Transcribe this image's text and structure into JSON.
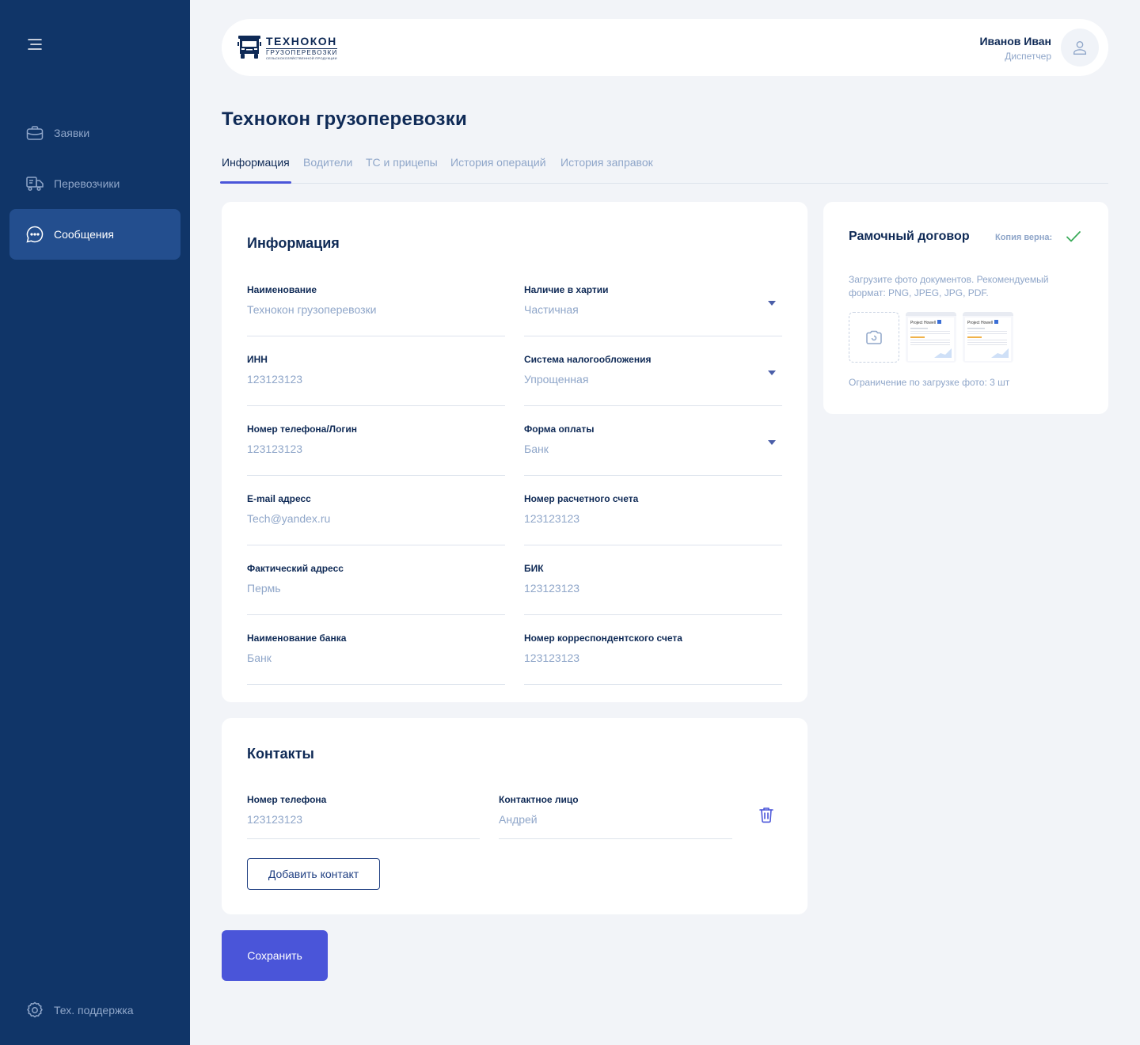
{
  "sidebar": {
    "menu_icon": "hamburger-icon",
    "items": [
      {
        "label": "Заявки",
        "icon": "briefcase-icon"
      },
      {
        "label": "Перевозчики",
        "icon": "truck-icon"
      },
      {
        "label": "Сообщения",
        "icon": "chat-icon",
        "active": true
      }
    ],
    "support": {
      "label": "Тех. поддержка",
      "icon": "gear-icon"
    }
  },
  "header": {
    "logo": {
      "title": "ТЕХНОКОН",
      "subtitle": "ГРУЗОПЕРЕВОЗКИ",
      "tagline": "СЕЛЬСКОХОЗЯЙСТВЕННОЙ ПРОДУКЦИИ"
    },
    "user": {
      "name": "Иванов Иван",
      "role": "Диспетчер"
    }
  },
  "page": {
    "title": "Технокон грузоперевозки"
  },
  "tabs": [
    "Информация",
    "Водители",
    "ТС и прицепы",
    "История операций",
    "История заправок"
  ],
  "info": {
    "title": "Информация",
    "fields": [
      {
        "label": "Наименование",
        "value": "Технокон грузоперевозки"
      },
      {
        "label": "Наличие в хартии",
        "value": "Частичная",
        "dropdown": true
      },
      {
        "label": "ИНН",
        "value": "123123123"
      },
      {
        "label": "Система налогообложения",
        "value": "Упрощенная",
        "dropdown": true
      },
      {
        "label": "Номер телефона/Логин",
        "value": "123123123"
      },
      {
        "label": "Форма оплаты",
        "value": "Банк",
        "dropdown": true
      },
      {
        "label": "E-mail адресс",
        "value": "Tech@yandex.ru"
      },
      {
        "label": "Номер расчетного счета",
        "value": "123123123"
      },
      {
        "label": "Фактический адресс",
        "value": "Пермь"
      },
      {
        "label": "БИК",
        "value": "123123123"
      },
      {
        "label": "Наименование банка",
        "value": "Банк"
      },
      {
        "label": "Номер корреспондентского счета",
        "value": "123123123"
      }
    ]
  },
  "contacts": {
    "title": "Контакты",
    "phone": {
      "label": "Номер телефона",
      "value": "123123123"
    },
    "person": {
      "label": "Контактное лицо",
      "value": "Андрей"
    },
    "add_button": "Добавить контакт"
  },
  "save_button": "Сохранить",
  "contract": {
    "title": "Рамочный договор",
    "copy_label": "Копия верна:",
    "hint": "Загрузите фото документов. Рекомендуемый формат: PNG, JPEG, JPG, PDF.",
    "limit": "Ограничение по загрузке фото: 3 шт",
    "thumb_title": "Project Howell"
  },
  "colors": {
    "sidebar": "#103568",
    "active_item": "#234e8e",
    "accent": "#4a55d9",
    "muted": "#8fa6c9",
    "check": "#3bab5a"
  }
}
